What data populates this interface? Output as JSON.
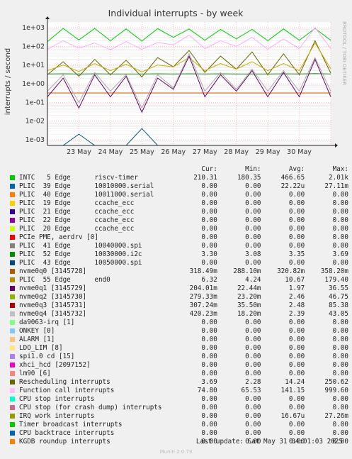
{
  "chart_data": {
    "type": "line",
    "title": "Individual interrupts - by week",
    "ylabel": "interrupts / second",
    "yscale": "log",
    "ylim": [
      0.0005,
      2000
    ],
    "yticks": [
      {
        "value": 1000,
        "label": "1e+03"
      },
      {
        "value": 100,
        "label": "1e+02"
      },
      {
        "value": 10,
        "label": "1e+01"
      },
      {
        "value": 1,
        "label": "1e+00"
      },
      {
        "value": 0.1,
        "label": "1e-01"
      },
      {
        "value": 0.01,
        "label": "1e-02"
      },
      {
        "value": 0.001,
        "label": "1e-03"
      }
    ],
    "x_range_days": [
      "22 May",
      "31 May"
    ],
    "xticks": [
      "23 May",
      "24 May",
      "25 May",
      "26 May",
      "27 May",
      "28 May",
      "29 May",
      "30 May"
    ],
    "side_label": "RRDTOOL / TOBI OETIKER",
    "series": [
      {
        "name": "INTC   5 Edge      riscv-timer",
        "color": "#00cc00",
        "values": [
          180,
          900,
          220,
          900,
          200,
          850,
          190,
          880,
          300,
          850,
          210,
          800,
          250,
          800,
          200,
          850,
          210,
          900,
          210
        ]
      },
      {
        "name": "Rescheduling interrupts",
        "color": "#666600",
        "values": [
          3,
          15,
          2.5,
          20,
          3,
          18,
          2.3,
          25,
          8,
          60,
          4,
          30,
          6,
          50,
          3,
          40,
          3,
          200,
          3.7
        ]
      },
      {
        "name": "Function call interrupts",
        "color": "#ffaaff",
        "values": [
          70,
          200,
          80,
          150,
          65,
          180,
          70,
          160,
          120,
          400,
          75,
          200,
          100,
          300,
          70,
          250,
          75,
          999,
          75
        ]
      },
      {
        "name": "nvme0q0 [3145728]",
        "color": "#cc6600",
        "values": [
          0.32,
          0.32,
          0.32,
          0.32,
          0.32,
          0.32,
          0.32,
          0.32,
          0.32,
          0.32,
          0.32,
          0.32,
          0.32,
          0.32,
          0.32,
          0.32,
          0.32,
          0.32,
          0.32
        ]
      },
      {
        "name": "PLIC  55 Edge      end0",
        "color": "#ccaa00",
        "values": [
          5,
          10,
          4.5,
          12,
          5,
          11,
          4.3,
          10,
          8,
          25,
          5,
          12,
          6,
          15,
          5,
          12,
          5,
          150,
          6.3
        ]
      },
      {
        "name": "PLIC  52 Edge      10030000.i2c",
        "color": "#228822",
        "values": [
          3.3,
          3.4,
          3.3,
          3.4,
          3.3,
          3.3,
          3.3,
          3.4,
          3.3,
          3.4,
          3.3,
          3.4,
          3.3,
          3.3,
          3.3,
          3.4,
          3.3,
          3.5,
          3.3
        ]
      },
      {
        "name": "nvme0q1 [3145729]",
        "color": "#660066",
        "values": [
          0.2,
          2,
          0.05,
          3,
          0.2,
          2.5,
          0.03,
          2,
          0.5,
          30,
          0.2,
          3,
          0.4,
          5,
          0.2,
          4,
          0.2,
          20,
          0.2
        ]
      },
      {
        "name": "nvme0q4 [3145732]",
        "color": "#aaaaaa",
        "values": [
          0.4,
          3,
          0.1,
          4,
          0.4,
          3,
          0.05,
          3,
          0.6,
          40,
          0.4,
          4,
          0.5,
          6,
          0.4,
          5,
          0.4,
          25,
          0.4
        ]
      },
      {
        "name": "PLIC  43 Edge      10050000.spi",
        "color": "#005577",
        "values": [
          0.0002,
          0.0002,
          0.002,
          0.0002,
          0.0002,
          0.0002,
          0.004,
          0.0002,
          0.0002,
          0.0002,
          0.0002,
          0.0002,
          0.0002,
          0.0002,
          0.0002,
          0.0002,
          0.0002,
          0.0002,
          0.0002
        ]
      }
    ]
  },
  "legend": {
    "headers": {
      "cur": "Cur:",
      "min": "Min:",
      "avg": "Avg:",
      "max": "Max:"
    },
    "rows": [
      {
        "color": "#00cc00",
        "name": "INTC   5 Edge      riscv-timer",
        "cur": "210.31",
        "min": "180.35",
        "avg": "466.65",
        "max": "2.01k"
      },
      {
        "color": "#0066b3",
        "name": "PLIC  39 Edge      10010000.serial",
        "cur": "0.00",
        "min": "0.00",
        "avg": "22.22u",
        "max": "27.11m"
      },
      {
        "color": "#ff8000",
        "name": "PLIC  40 Edge      10011000.serial",
        "cur": "0.00",
        "min": "0.00",
        "avg": "0.00",
        "max": "0.00"
      },
      {
        "color": "#ffcc00",
        "name": "PLIC  19 Edge      ccache_ecc",
        "cur": "0.00",
        "min": "0.00",
        "avg": "0.00",
        "max": "0.00"
      },
      {
        "color": "#330099",
        "name": "PLIC  21 Edge      ccache_ecc",
        "cur": "0.00",
        "min": "0.00",
        "avg": "0.00",
        "max": "0.00"
      },
      {
        "color": "#990099",
        "name": "PLIC  22 Edge      ccache_ecc",
        "cur": "0.00",
        "min": "0.00",
        "avg": "0.00",
        "max": "0.00"
      },
      {
        "color": "#ccff00",
        "name": "PLIC  20 Edge      ccache_ecc",
        "cur": "0.00",
        "min": "0.00",
        "avg": "0.00",
        "max": "0.00"
      },
      {
        "color": "#ff0000",
        "name": "PCIe PME, aerdrv [0]",
        "cur": "0.00",
        "min": "0.00",
        "avg": "0.00",
        "max": "0.00"
      },
      {
        "color": "#808080",
        "name": "PLIC  41 Edge      10040000.spi",
        "cur": "0.00",
        "min": "0.00",
        "avg": "0.00",
        "max": "0.00"
      },
      {
        "color": "#008f00",
        "name": "PLIC  52 Edge      10030000.i2c",
        "cur": "3.30",
        "min": "3.08",
        "avg": "3.35",
        "max": "3.69"
      },
      {
        "color": "#00487d",
        "name": "PLIC  43 Edge      10050000.spi",
        "cur": "0.00",
        "min": "0.00",
        "avg": "0.00",
        "max": "0.00"
      },
      {
        "color": "#b35a00",
        "name": "nvme0q0 [3145728]",
        "cur": "318.49m",
        "min": "288.10m",
        "avg": "320.82m",
        "max": "358.20m"
      },
      {
        "color": "#b38f00",
        "name": "PLIC  55 Edge      end0",
        "cur": "6.32",
        "min": "4.24",
        "avg": "10.67",
        "max": "179.40"
      },
      {
        "color": "#6b006b",
        "name": "nvme0q1 [3145729]",
        "cur": "204.01m",
        "min": "22.44m",
        "avg": "1.97",
        "max": "36.55"
      },
      {
        "color": "#8fb300",
        "name": "nvme0q2 [3145730]",
        "cur": "279.33m",
        "min": "23.20m",
        "avg": "2.46",
        "max": "46.75"
      },
      {
        "color": "#b30000",
        "name": "nvme0q3 [3145731]",
        "cur": "307.24m",
        "min": "35.50m",
        "avg": "2.48",
        "max": "85.38"
      },
      {
        "color": "#bebebe",
        "name": "nvme0q4 [3145732]",
        "cur": "420.23m",
        "min": "18.20m",
        "avg": "2.39",
        "max": "43.05"
      },
      {
        "color": "#80ff80",
        "name": "da9063-irq [1]",
        "cur": "0.00",
        "min": "0.00",
        "avg": "0.00",
        "max": "0.00"
      },
      {
        "color": "#80c9ff",
        "name": "ONKEY [0]",
        "cur": "0.00",
        "min": "0.00",
        "avg": "0.00",
        "max": "0.00"
      },
      {
        "color": "#ffc080",
        "name": "ALARM [1]",
        "cur": "0.00",
        "min": "0.00",
        "avg": "0.00",
        "max": "0.00"
      },
      {
        "color": "#ffe680",
        "name": "LDO_LIM [8]",
        "cur": "0.00",
        "min": "0.00",
        "avg": "0.00",
        "max": "0.00"
      },
      {
        "color": "#aa80ff",
        "name": "spi1.0 cd [15]",
        "cur": "0.00",
        "min": "0.00",
        "avg": "0.00",
        "max": "0.00"
      },
      {
        "color": "#ee00cc",
        "name": "xhci_hcd [2097152]",
        "cur": "0.00",
        "min": "0.00",
        "avg": "0.00",
        "max": "0.00"
      },
      {
        "color": "#ff8080",
        "name": "lm90 [6]",
        "cur": "0.00",
        "min": "0.00",
        "avg": "0.00",
        "max": "0.00"
      },
      {
        "color": "#666600",
        "name": "Rescheduling interrupts",
        "cur": "3.69",
        "min": "2.28",
        "avg": "14.24",
        "max": "250.62"
      },
      {
        "color": "#ffbfff",
        "name": "Function call interrupts",
        "cur": "74.80",
        "min": "65.53",
        "avg": "141.15",
        "max": "999.60"
      },
      {
        "color": "#00ffcc",
        "name": "CPU stop interrupts",
        "cur": "0.00",
        "min": "0.00",
        "avg": "0.00",
        "max": "0.00"
      },
      {
        "color": "#cc6699",
        "name": "CPU stop (for crash dump) interrupts",
        "cur": "0.00",
        "min": "0.00",
        "avg": "0.00",
        "max": "0.00"
      },
      {
        "color": "#999900",
        "name": "IRQ work interrupts",
        "cur": "0.00",
        "min": "0.00",
        "avg": "16.67u",
        "max": "27.26m"
      },
      {
        "color": "#00cc00",
        "name": "Timer broadcast interrupts",
        "cur": "0.00",
        "min": "0.00",
        "avg": "0.00",
        "max": "0.00"
      },
      {
        "color": "#0066b3",
        "name": "CPU backtrace interrupts",
        "cur": "0.00",
        "min": "0.00",
        "avg": "0.00",
        "max": "0.00"
      },
      {
        "color": "#ff8000",
        "name": "KGDB roundup interrupts",
        "cur": "0.00",
        "min": "0.00",
        "avg": "0.00",
        "max": "0.00"
      }
    ]
  },
  "footer": {
    "last_update": "Last update: Sat May 31 04:01:03 2025",
    "generator": "Munin 2.0.73"
  }
}
